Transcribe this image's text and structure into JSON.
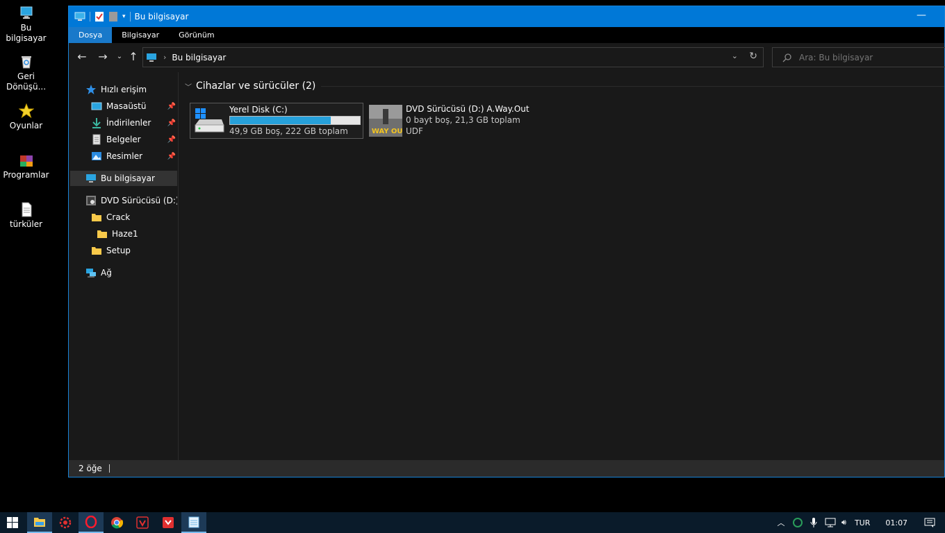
{
  "desktop": {
    "icons": [
      {
        "label": "Bu bilgisayar"
      },
      {
        "label": "Geri Dönüşü..."
      },
      {
        "label": "Oyunlar"
      },
      {
        "label": "Programlar"
      },
      {
        "label": "türküler"
      }
    ]
  },
  "window": {
    "title": "Bu bilgisayar",
    "ribbon_tabs": [
      "Dosya",
      "Bilgisayar",
      "Görünüm"
    ],
    "address": {
      "crumb": "Bu bilgisayar"
    },
    "search": {
      "placeholder": "Ara: Bu bilgisayar"
    },
    "sidebar": {
      "quick_access": "Hızlı erişim",
      "items": [
        {
          "label": "Masaüstü"
        },
        {
          "label": "İndirilenler"
        },
        {
          "label": "Belgeler"
        },
        {
          "label": "Resimler"
        }
      ],
      "this_pc": "Bu bilgisayar",
      "dvd": "DVD Sürücüsü (D:) A.",
      "folders": [
        "Crack",
        "Haze1",
        "Setup"
      ],
      "network": "Ağ"
    },
    "group": {
      "title": "Cihazlar ve sürücüler (2)"
    },
    "drives": [
      {
        "name": "Yerel Disk (C:)",
        "detail": "49,9 GB boş, 222 GB toplam",
        "used_fraction": 0.775
      },
      {
        "name": "DVD Sürücüsü (D:) A.Way.Out",
        "detail": "0 bayt boş, 21,3 GB toplam",
        "fs": "UDF",
        "cover_text": "A WAY OUT"
      }
    ],
    "status": {
      "count": "2 öğe"
    }
  },
  "taskbar": {
    "tray": {
      "lang": "TUR",
      "time": "01:07"
    }
  },
  "colors": {
    "accent": "#0078d7",
    "progress": "#26a0da",
    "folder": "#f8c94a"
  }
}
